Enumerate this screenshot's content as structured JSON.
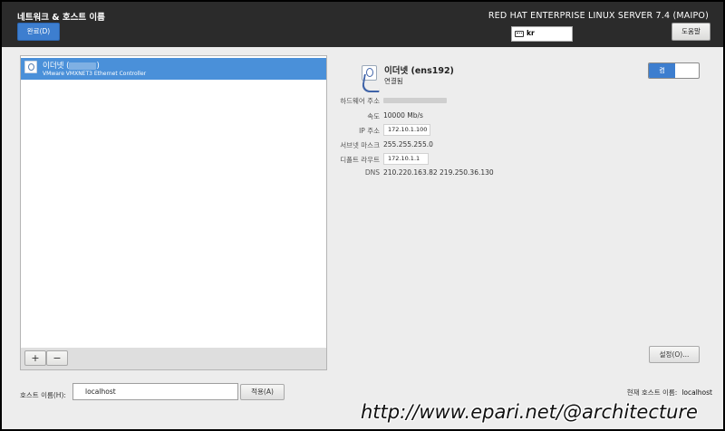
{
  "header": {
    "title": "네트워크 & 호스트 이름",
    "done_label": "완료(D)",
    "product": "RED HAT ENTERPRISE LINUX SERVER 7.4 (MAIPO)",
    "keyboard_layout": "kr",
    "help_label": "도움말"
  },
  "devices": [
    {
      "name_prefix": "이더넷 (",
      "name_suffix": ")",
      "description": "VMware VMXNET3 Ethernet Controller"
    }
  ],
  "list_toolbar": {
    "add_label": "+",
    "remove_label": "−"
  },
  "detail": {
    "name": "이더넷 (ens192)",
    "status": "연결됨",
    "toggle_label": "켬",
    "hw_label": "하드웨어 주소",
    "speed_label": "속도",
    "speed_value": "10000 Mb/s",
    "ip_label": "IP 주소",
    "ip_value": "172.10.1.100",
    "mask_label": "서브넷 마스크",
    "mask_value": "255.255.255.0",
    "route_label": "디폴트 라우트",
    "route_value": "172.10.1.1",
    "dns_label": "DNS",
    "dns_value": "210.220.163.82 219.250.36.130",
    "settings_label": "설정(O)..."
  },
  "hostname": {
    "label": "호스트 이름(H):",
    "value": "localhost",
    "apply_label": "적용(A)",
    "current_label": "현재 호스트 이름:",
    "current_value": "localhost"
  },
  "watermark": "http://www.epari.net/@architecture",
  "colors": {
    "accent": "#3d7ecf",
    "header_bg": "#2b2b2b",
    "selection": "#4a90d9"
  }
}
